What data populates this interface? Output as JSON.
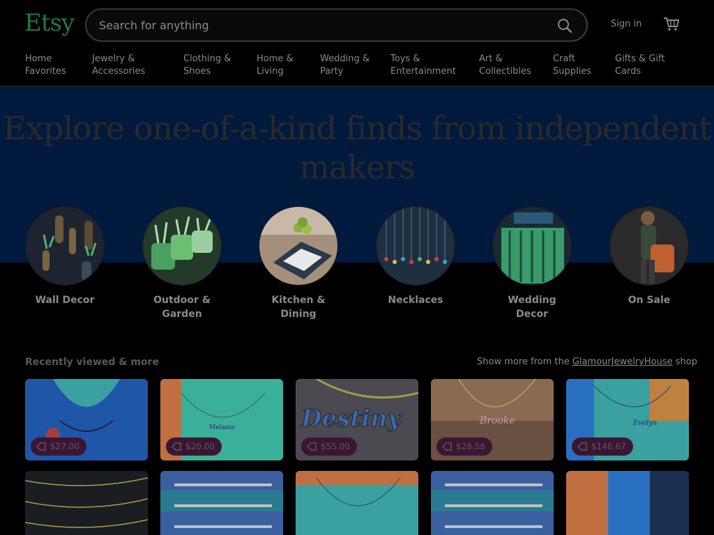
{
  "header": {
    "logo": "Etsy",
    "search_placeholder": "Search for anything",
    "signin_label": "Sign in"
  },
  "nav": {
    "items": [
      {
        "line1": "Home",
        "line2": "Favorites"
      },
      {
        "line1": "Jewelry &",
        "line2": "Accessories"
      },
      {
        "line1": "Clothing &",
        "line2": "Shoes"
      },
      {
        "line1": "Home &",
        "line2": "Living"
      },
      {
        "line1": "Wedding &",
        "line2": "Party"
      },
      {
        "line1": "Toys &",
        "line2": "Entertainment"
      },
      {
        "line1": "Art &",
        "line2": "Collectibles"
      },
      {
        "line1": "Craft",
        "line2": "Supplies"
      },
      {
        "line1": "Gifts & Gift",
        "line2": "Cards"
      }
    ]
  },
  "hero": {
    "title_line1": "Explore one-of-a-kind finds from independent",
    "title_line2": "makers"
  },
  "categories": [
    {
      "line1": "Wall Decor",
      "line2": ""
    },
    {
      "line1": "Outdoor &",
      "line2": "Garden"
    },
    {
      "line1": "Kitchen &",
      "line2": "Dining"
    },
    {
      "line1": "Necklaces",
      "line2": ""
    },
    {
      "line1": "Wedding",
      "line2": "Decor"
    },
    {
      "line1": "On Sale",
      "line2": ""
    }
  ],
  "recent": {
    "title": "Recently viewed & more",
    "more_prefix": "Show more from the",
    "shop_name": "GlamourJewelryHouse",
    "more_suffix": "shop",
    "row1_prices": [
      "$27.00",
      "$20.00",
      "$55.00",
      "$28.58",
      "$146.67"
    ]
  },
  "colors": {
    "brand": "#1f7a43",
    "hero_bg": "#001a3d",
    "price_pill": "#3b1633"
  }
}
